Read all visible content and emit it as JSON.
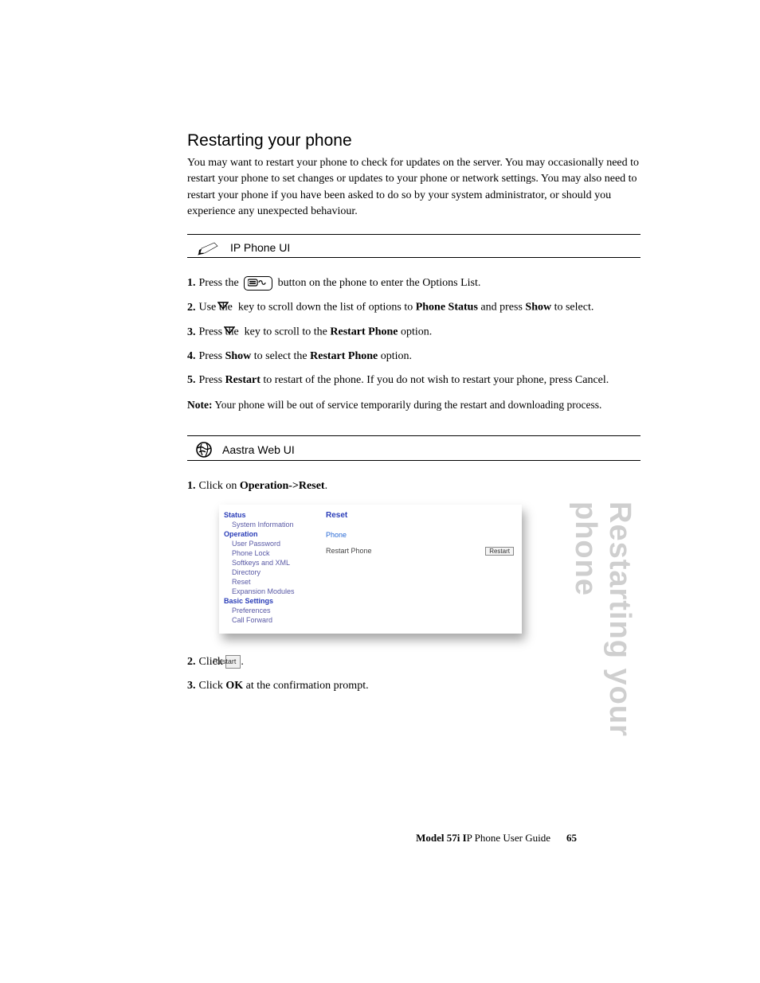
{
  "side_title": "Restarting your phone",
  "heading": "Restarting your phone",
  "intro": "You may want to restart your phone to check for updates on the server. You may occasionally need to restart your phone to set changes or updates to your phone or network settings.   You may also need to restart your phone if you have been asked to do so by your system administrator, or should you experience any unexpected behaviour.",
  "ip_ui_label": "IP Phone UI",
  "ip_steps": {
    "s1_a": "Press the ",
    "s1_b": " button on the phone to enter the Options List.",
    "s2_a": "Use the ",
    "s2_b": " key to scroll down the list of options to ",
    "s2_c": "Phone Status",
    "s2_d": " and press ",
    "s2_e": "Show",
    "s2_f": " to select.",
    "s3_a": "Press the ",
    "s3_b": " key to scroll to the ",
    "s3_c": "Restart Phone",
    "s3_d": " option.",
    "s4_a": "Press ",
    "s4_b": "Show",
    "s4_c": " to select the ",
    "s4_d": "Restart Phone",
    "s4_e": " option.",
    "s5_a": "Press ",
    "s5_b": "Restart",
    "s5_c": " to restart of the phone. If you do not wish to restart your phone, press Cancel."
  },
  "note_label": "Note:",
  "note_text": " Your phone will be out of service temporarily during the restart and downloading process.",
  "web_ui_label": "Aastra Web UI",
  "web_steps": {
    "s1_a": "Click on ",
    "s1_b": "Operation->Reset",
    "s1_c": ".",
    "s2_a": "Click ",
    "s2_b": "Restart",
    "s2_c": ".",
    "s3_a": "Click ",
    "s3_b": "OK",
    "s3_c": " at the confirmation prompt."
  },
  "screenshot": {
    "side": {
      "hdr1": "Status",
      "item1": "System Information",
      "hdr2": "Operation",
      "item2": "User Password",
      "item3": "Phone Lock",
      "item4": "Softkeys and XML",
      "item5": "Directory",
      "item6": "Reset",
      "item7": "Expansion Modules",
      "hdr3": "Basic Settings",
      "item8": "Preferences",
      "item9": "Call Forward"
    },
    "main": {
      "title": "Reset",
      "sub": "Phone",
      "row_label": "Restart Phone",
      "row_btn": "Restart"
    }
  },
  "footer": {
    "model": "Model 57i I",
    "tail": "P Phone User Guide",
    "page": "65"
  }
}
